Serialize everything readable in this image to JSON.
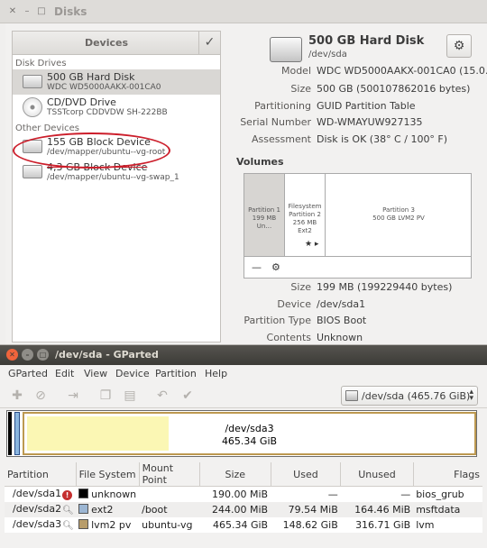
{
  "disks": {
    "title": "Disks",
    "devices_header": "Devices",
    "section_drives": "Disk Drives",
    "section_other": "Other Devices",
    "drives": [
      {
        "name": "500 GB Hard Disk",
        "sub": "WDC WD5000AAKX-001CA0"
      },
      {
        "name": "CD/DVD Drive",
        "sub": "TSSTcorp CDDVDW SH-222BB"
      }
    ],
    "other_devices": [
      {
        "name": "155 GB Block Device",
        "sub": "/dev/mapper/ubuntu--vg-root"
      },
      {
        "name": "4,3 GB Block Device",
        "sub": "/dev/mapper/ubuntu--vg-swap_1"
      }
    ],
    "detail": {
      "title": "500 GB Hard Disk",
      "device": "/dev/sda",
      "props": [
        {
          "k": "Model",
          "v": "WDC WD5000AAKX-001CA0 (15.0…"
        },
        {
          "k": "Size",
          "v": "500 GB (500107862016 bytes)"
        },
        {
          "k": "Partitioning",
          "v": "GUID Partition Table"
        },
        {
          "k": "Serial Number",
          "v": "WD-WMAYUW927135"
        },
        {
          "k": "Assessment",
          "v": "Disk is OK (38° C / 100° F)"
        }
      ],
      "volumes_label": "Volumes",
      "partitions": [
        {
          "line1": "Partition 1",
          "line2": "199 MB Un…"
        },
        {
          "line1": "Filesystem",
          "line2": "Partition 2",
          "line3": "256 MB Ext2"
        },
        {
          "line1": "Partition 3",
          "line2": "500 GB LVM2 PV"
        }
      ],
      "vol_props": [
        {
          "k": "Size",
          "v": "199 MB (199229440 bytes)"
        },
        {
          "k": "Device",
          "v": "/dev/sda1"
        },
        {
          "k": "Partition Type",
          "v": "BIOS Boot"
        },
        {
          "k": "Contents",
          "v": "Unknown"
        }
      ]
    }
  },
  "gparted": {
    "title": "/dev/sda - GParted",
    "menu": [
      "GParted",
      "Edit",
      "View",
      "Device",
      "Partition",
      "Help"
    ],
    "device_select": "/dev/sda   (465.76 GiB)",
    "visual_label": "/dev/sda3",
    "visual_size": "465.34 GiB",
    "columns": [
      "Partition",
      "File System",
      "Mount Point",
      "Size",
      "Used",
      "Unused",
      "Flags"
    ],
    "rows": [
      {
        "partition": "/dev/sda1",
        "fs": "unknown",
        "mount": "",
        "size": "190.00 MiB",
        "used": "—",
        "unused": "—",
        "flags": "bios_grub",
        "color": "#000000",
        "icon": "warning"
      },
      {
        "partition": "/dev/sda2",
        "fs": "ext2",
        "mount": "/boot",
        "size": "244.00 MiB",
        "used": "79.54 MiB",
        "unused": "164.46 MiB",
        "flags": "msftdata",
        "color": "#9cb6d3",
        "icon": "key"
      },
      {
        "partition": "/dev/sda3",
        "fs": "lvm2 pv",
        "mount": "ubuntu-vg",
        "size": "465.34 GiB",
        "used": "148.62 GiB",
        "unused": "316.71 GiB",
        "flags": "lvm",
        "color": "#b89d6b",
        "icon": "key"
      }
    ]
  }
}
